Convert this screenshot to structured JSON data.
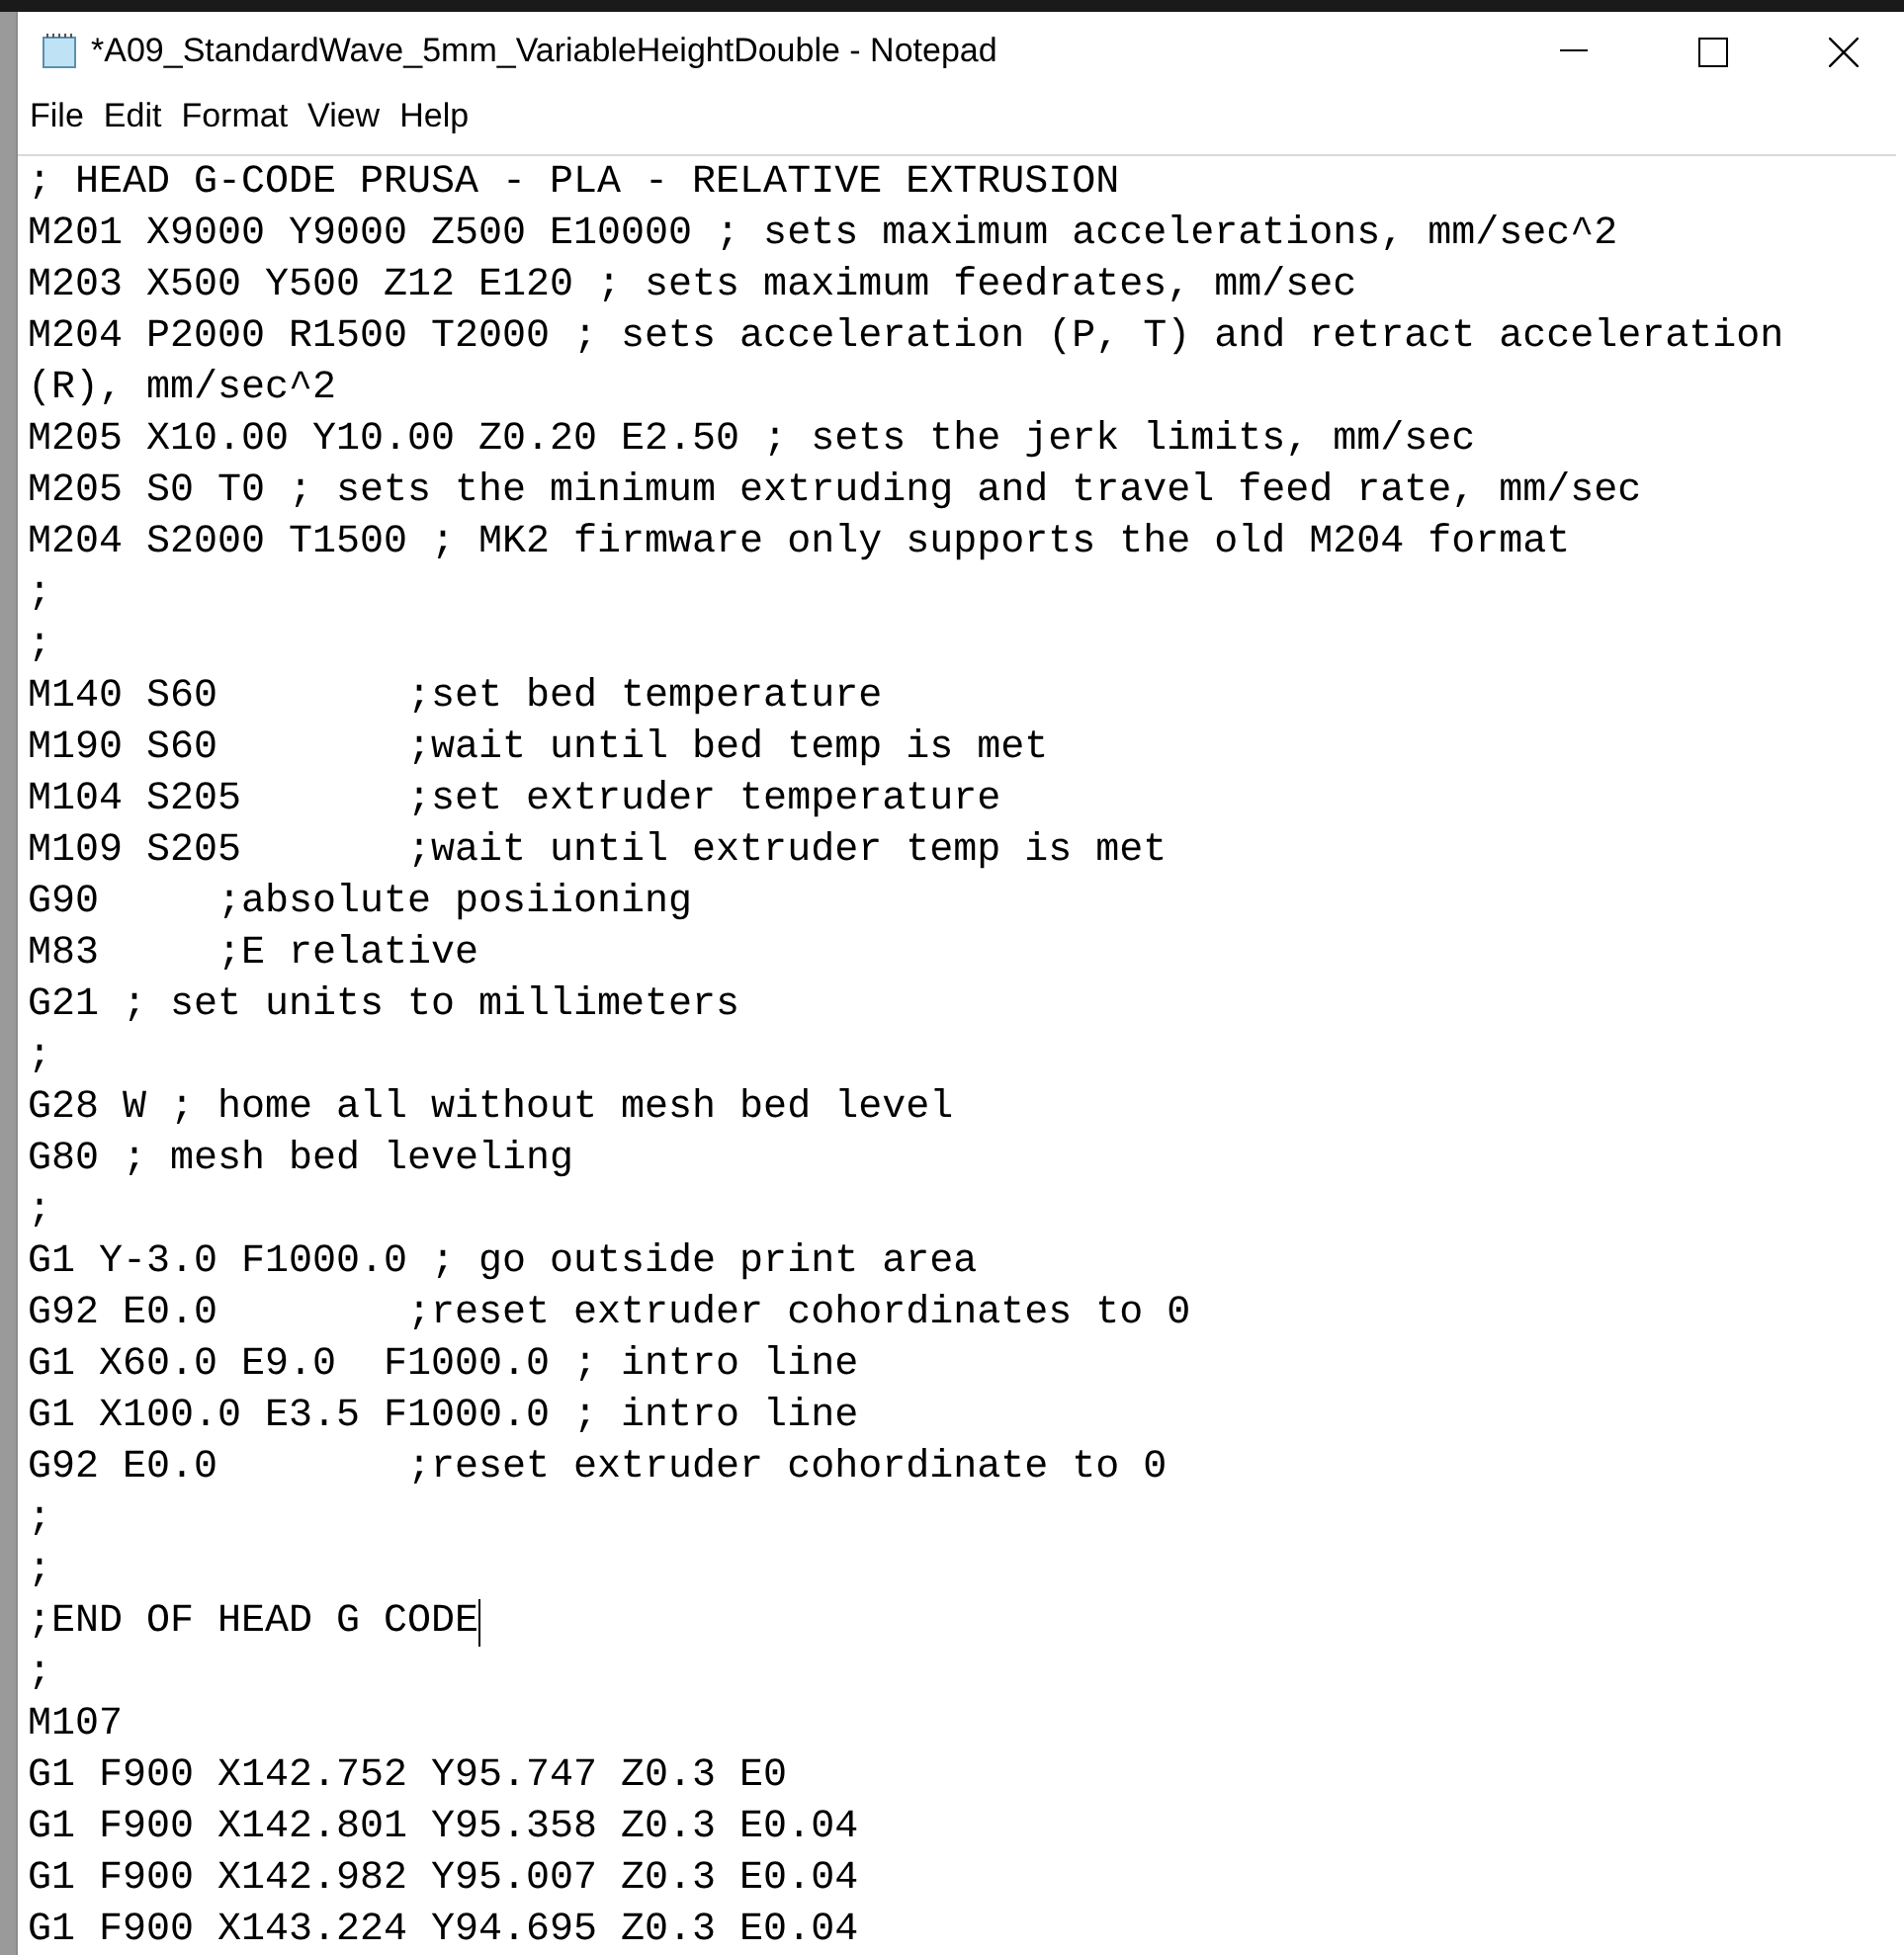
{
  "window": {
    "title": "*A09_StandardWave_5mm_VariableHeightDouble - Notepad"
  },
  "menu": [
    "File",
    "Edit",
    "Format",
    "View",
    "Help"
  ],
  "lines": [
    {
      "text": "; HEAD G-CODE PRUSA - PLA - RELATIVE EXTRUSION",
      "caret": false
    },
    {
      "text": "M201 X9000 Y9000 Z500 E10000 ; sets maximum accelerations, mm/sec^2",
      "caret": false
    },
    {
      "text": "M203 X500 Y500 Z12 E120 ; sets maximum feedrates, mm/sec",
      "caret": false
    },
    {
      "text": "M204 P2000 R1500 T2000 ; sets acceleration (P, T) and retract acceleration (R), mm/sec^2",
      "caret": false
    },
    {
      "text": "M205 X10.00 Y10.00 Z0.20 E2.50 ; sets the jerk limits, mm/sec",
      "caret": false
    },
    {
      "text": "M205 S0 T0 ; sets the minimum extruding and travel feed rate, mm/sec",
      "caret": false
    },
    {
      "text": "M204 S2000 T1500 ; MK2 firmware only supports the old M204 format",
      "caret": false
    },
    {
      "text": ";",
      "caret": false
    },
    {
      "text": ";",
      "caret": false
    },
    {
      "text": "M140 S60\t;set bed temperature",
      "caret": false
    },
    {
      "text": "M190 S60\t;wait until bed temp is met",
      "caret": false
    },
    {
      "text": "M104 S205\t;set extruder temperature",
      "caret": false
    },
    {
      "text": "M109 S205\t;wait until extruder temp is met",
      "caret": false
    },
    {
      "text": "G90\t;absolute posiioning",
      "caret": false
    },
    {
      "text": "M83\t;E relative",
      "caret": false
    },
    {
      "text": "G21 ; set units to millimeters",
      "caret": false
    },
    {
      "text": ";",
      "caret": false
    },
    {
      "text": "G28 W ; home all without mesh bed level",
      "caret": false
    },
    {
      "text": "G80 ; mesh bed leveling",
      "caret": false
    },
    {
      "text": ";",
      "caret": false
    },
    {
      "text": "G1 Y-3.0 F1000.0 ; go outside print area",
      "caret": false
    },
    {
      "text": "G92 E0.0\t;reset extruder cohordinates to 0",
      "caret": false
    },
    {
      "text": "G1 X60.0 E9.0  F1000.0 ; intro line",
      "caret": false
    },
    {
      "text": "G1 X100.0 E3.5 F1000.0 ; intro line",
      "caret": false
    },
    {
      "text": "G92 E0.0\t;reset extruder cohordinate to 0",
      "caret": false
    },
    {
      "text": ";",
      "caret": false
    },
    {
      "text": ";",
      "caret": false
    },
    {
      "text": ";END OF HEAD G CODE",
      "caret": true
    },
    {
      "text": ";",
      "caret": false
    },
    {
      "text": "M107",
      "caret": false
    },
    {
      "text": "G1 F900 X142.752 Y95.747 Z0.3 E0",
      "caret": false
    },
    {
      "text": "G1 F900 X142.801 Y95.358 Z0.3 E0.04",
      "caret": false
    },
    {
      "text": "G1 F900 X142.982 Y95.007 Z0.3 E0.04",
      "caret": false
    },
    {
      "text": "G1 F900 X143.224 Y94.695 Z0.3 E0.04",
      "caret": false
    }
  ]
}
